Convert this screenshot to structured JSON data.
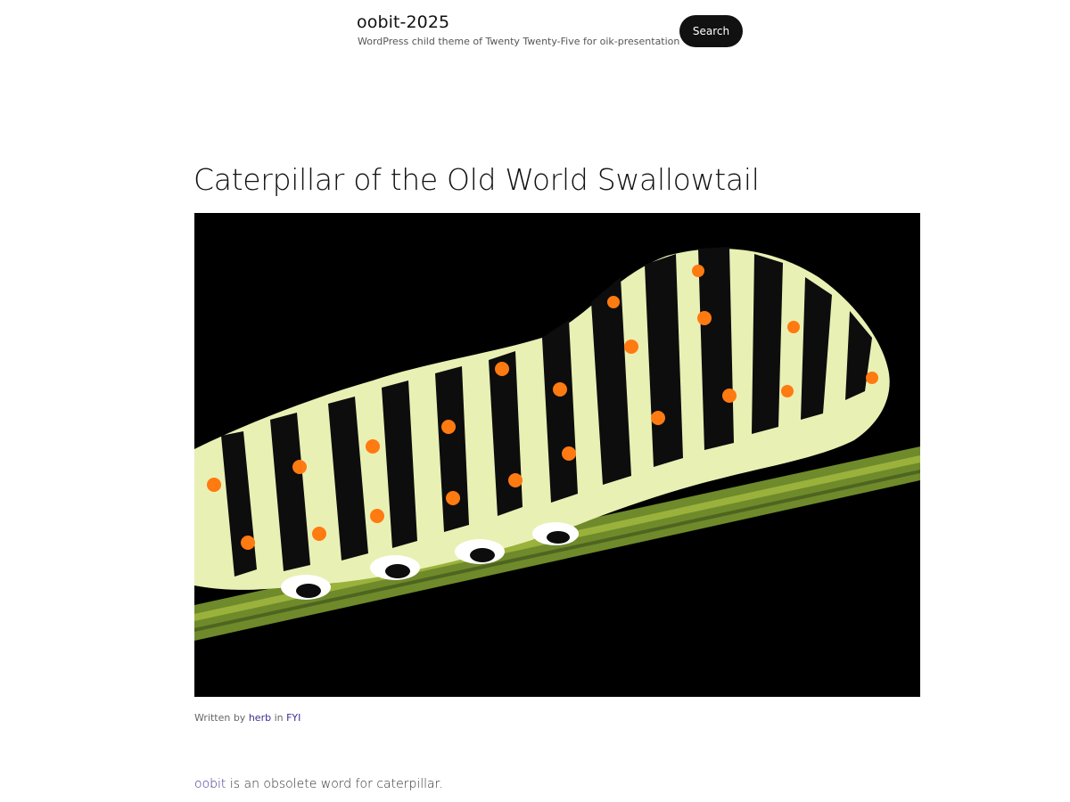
{
  "header": {
    "site_title": "oobit-2025",
    "tagline": "WordPress child theme of Twenty Twenty-Five for oik-presentation",
    "search_label": "Search"
  },
  "post": {
    "title": "Caterpillar of the Old World Swallowtail",
    "meta": {
      "written_by_prefix": "Written by",
      "author": "herb",
      "in_word": "in",
      "category": "FYI"
    },
    "content": {
      "link_text": "oobit",
      "rest": " is an obsolete word for caterpillar."
    }
  },
  "colors": {
    "link": "#3a2f8f",
    "button_bg": "#111111",
    "image_bg": "#000000"
  },
  "icons": {
    "featured_image": "caterpillar-photo"
  }
}
